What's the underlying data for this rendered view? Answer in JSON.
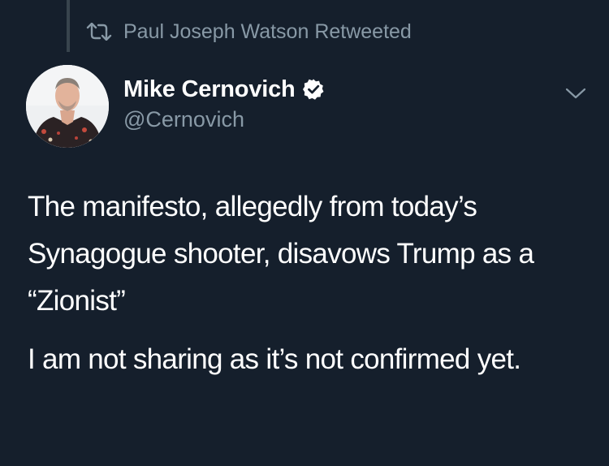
{
  "retweet": {
    "icon": "retweet-icon",
    "label": "Paul Joseph Watson Retweeted"
  },
  "author": {
    "display_name": "Mike Cernovich",
    "handle": "@Cernovich",
    "verified": true,
    "verified_icon": "verified-badge-icon",
    "avatar": "avatar"
  },
  "menu": {
    "icon": "chevron-down-icon"
  },
  "tweet": {
    "paragraph_1": "The manifesto, allegedly from today’s Synagogue shooter, disavows Trump as a “Zionist”",
    "paragraph_2": "I am not sharing as it’s not confirmed yet."
  },
  "colors": {
    "background": "#151f2c",
    "text_primary": "#ffffff",
    "text_secondary": "#8899a6",
    "verified_blue": "#1da1f2"
  }
}
